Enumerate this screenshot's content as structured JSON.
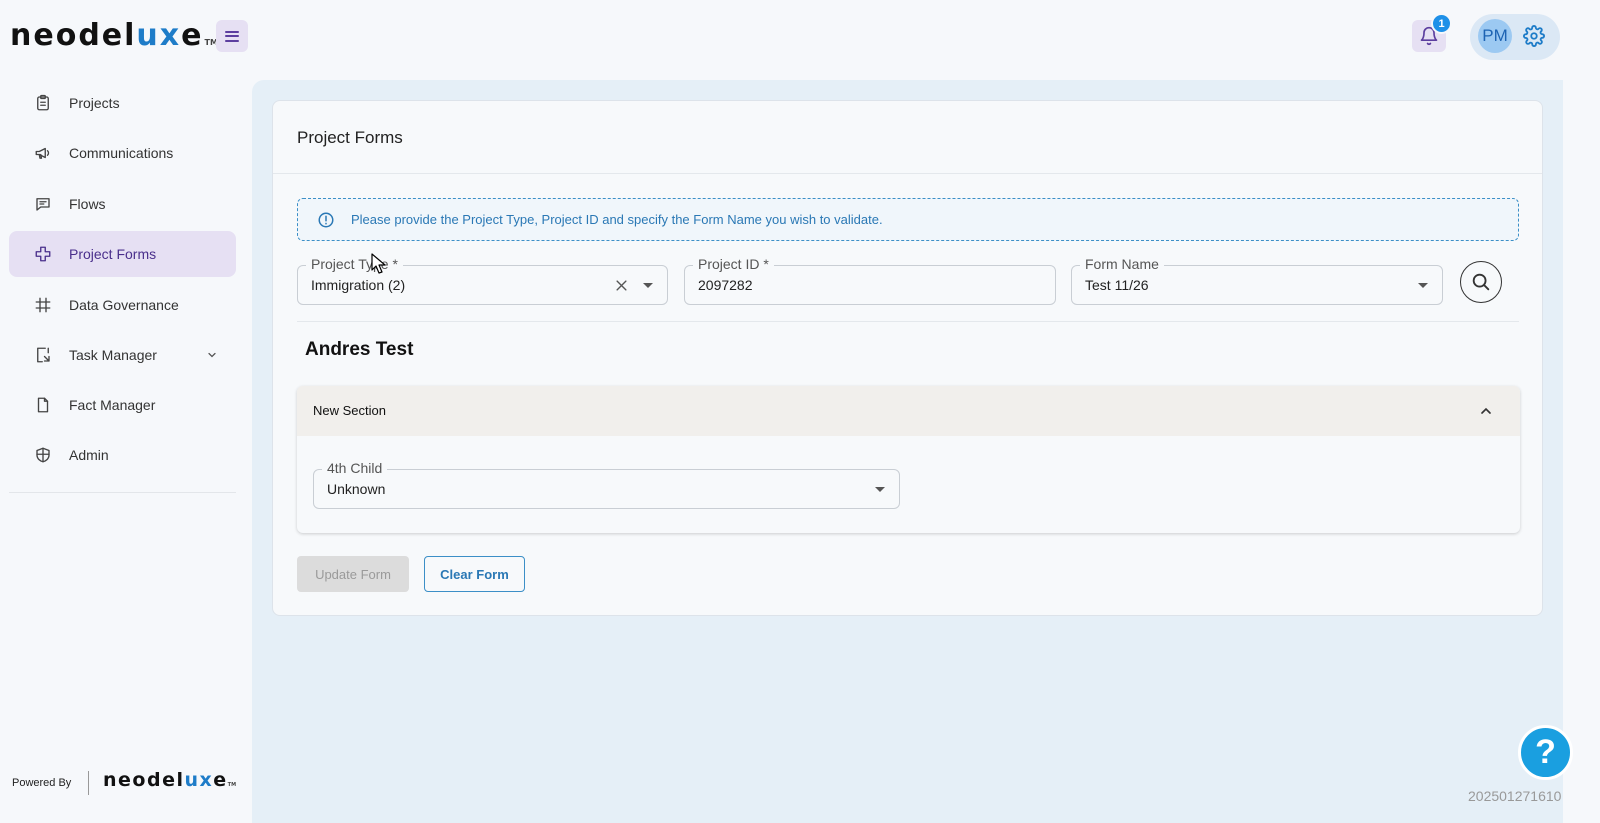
{
  "brand": {
    "logo_pre": "neodel",
    "logo_ux": "ux",
    "logo_post": "e",
    "tm": "TM"
  },
  "header": {
    "notifications_count": "1",
    "avatar_initials": "PM"
  },
  "sidebar": {
    "items": [
      {
        "label": "Projects",
        "icon": "clipboard-icon"
      },
      {
        "label": "Communications",
        "icon": "megaphone-icon"
      },
      {
        "label": "Flows",
        "icon": "chat-icon"
      },
      {
        "label": "Project Forms",
        "icon": "flow-icon",
        "active": true
      },
      {
        "label": "Data Governance",
        "icon": "grid-icon"
      },
      {
        "label": "Task Manager",
        "icon": "task-icon",
        "expandable": true
      },
      {
        "label": "Fact Manager",
        "icon": "document-icon"
      },
      {
        "label": "Admin",
        "icon": "shield-icon"
      }
    ],
    "powered_by": "Powered By"
  },
  "page": {
    "title": "Project Forms",
    "info_message": "Please provide the Project Type, Project ID and specify the Form Name you wish to validate.",
    "project_type": {
      "label": "Project Type *",
      "value": "Immigration (2)"
    },
    "project_id": {
      "label": "Project ID *",
      "value": "2097282"
    },
    "form_name": {
      "label": "Form Name",
      "value": "Test 11/26"
    },
    "form_title": "Andres Test",
    "section": {
      "title": "New Section",
      "field_label": "4th Child",
      "field_value": "Unknown"
    },
    "update_button": "Update Form",
    "clear_button": "Clear Form"
  },
  "footer": {
    "build_number": "202501271610"
  },
  "colors": {
    "accent": "#1e7cc8",
    "nav_active_bg": "#e6e0f3",
    "nav_active_text": "#4a2f8c",
    "info": "#2a78b5"
  }
}
